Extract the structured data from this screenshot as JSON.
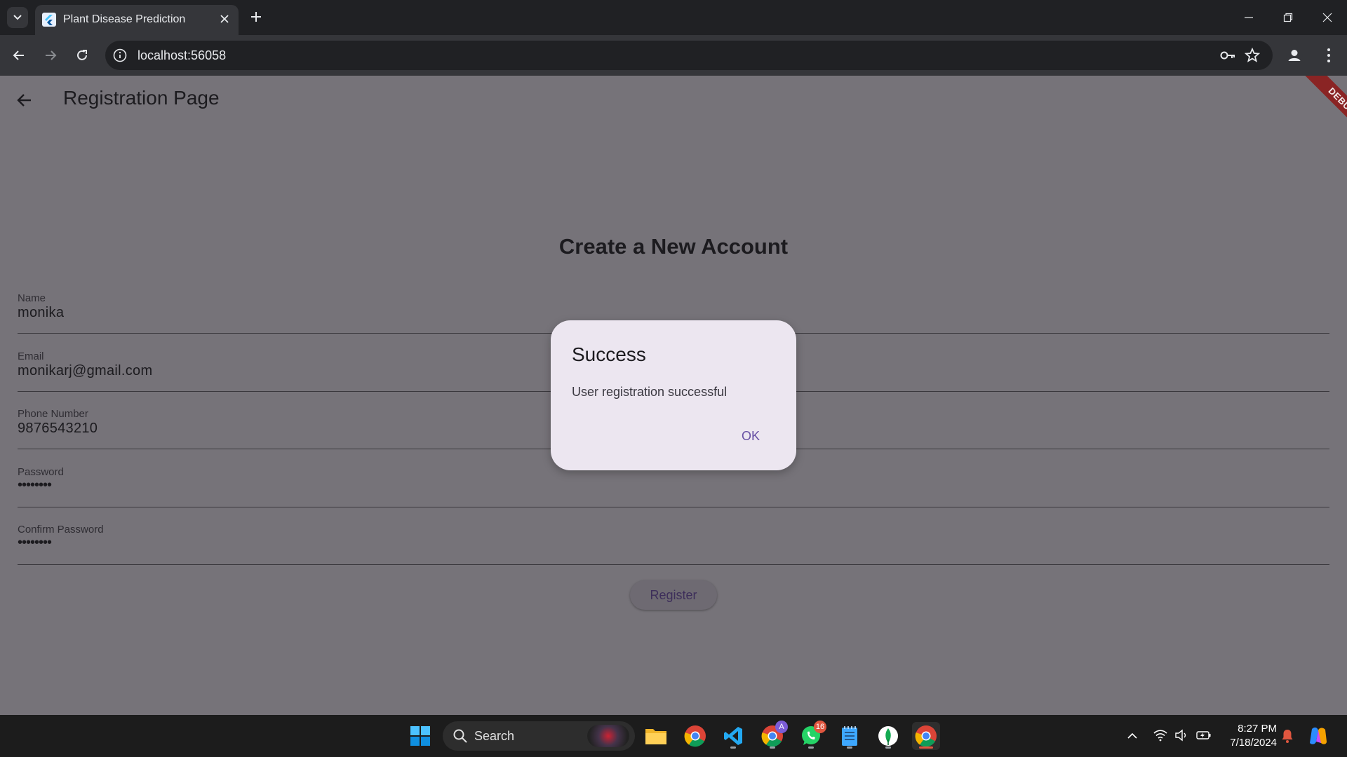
{
  "browser": {
    "tab_title": "Plant Disease Prediction",
    "url": "localhost:56058"
  },
  "app": {
    "appbar_title": "Registration Page",
    "debug_banner": "DEBUG",
    "form_heading": "Create a New Account",
    "fields": [
      {
        "label": "Name",
        "value": "monika"
      },
      {
        "label": "Email",
        "value": "monikarj@gmail.com"
      },
      {
        "label": "Phone Number",
        "value": "9876543210"
      },
      {
        "label": "Password",
        "value": "••••••••"
      },
      {
        "label": "Confirm Password",
        "value": "••••••••"
      }
    ],
    "register_label": "Register"
  },
  "dialog": {
    "title": "Success",
    "message": "User registration successful",
    "ok_label": "OK"
  },
  "taskbar": {
    "search_label": "Search",
    "whatsapp_badge": "16",
    "chrome_profile_badge": "A",
    "time": "8:27 PM",
    "date": "7/18/2024"
  }
}
